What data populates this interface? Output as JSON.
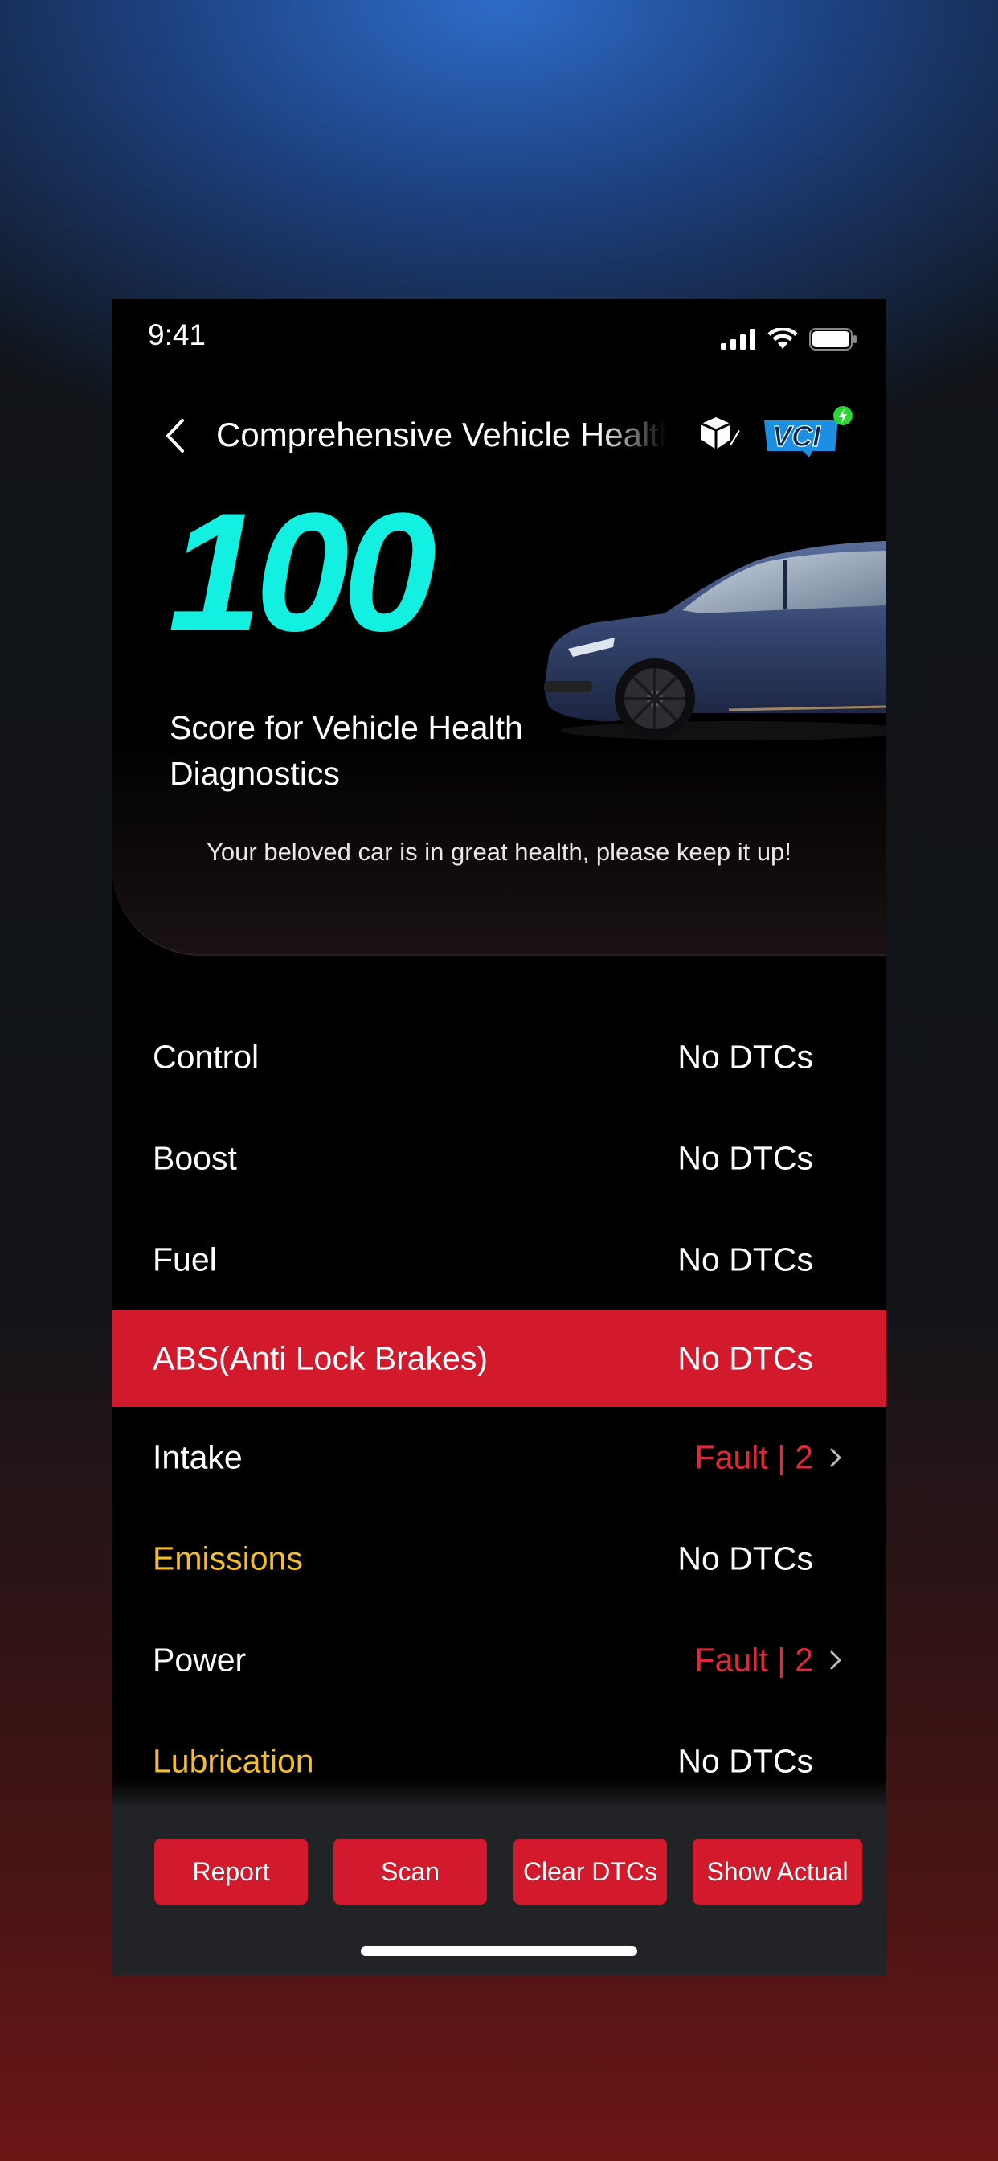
{
  "status_bar": {
    "time": "9:41",
    "icons": [
      "cellular-signal-icon",
      "wifi-icon",
      "battery-icon"
    ]
  },
  "nav": {
    "back_icon": "chevron-left-icon",
    "title": "Comprehensive Vehicle Health Diagnostics",
    "actions": [
      {
        "name": "cube-pencil-icon"
      },
      {
        "name": "vci-connection-icon",
        "label": "VCI",
        "status_color": "#2bd434"
      }
    ]
  },
  "hero": {
    "score": "100",
    "score_label": "Score for Vehicle Health Diagnostics",
    "message": "Your beloved car is in great health, please keep it up!"
  },
  "systems": [
    {
      "name": "Control",
      "status": "No DTCs",
      "fault": false,
      "highlight": false,
      "warning": false
    },
    {
      "name": "Boost",
      "status": "No DTCs",
      "fault": false,
      "highlight": false,
      "warning": false
    },
    {
      "name": "Fuel",
      "status": "No DTCs",
      "fault": false,
      "highlight": false,
      "warning": false
    },
    {
      "name": "ABS(Anti Lock Brakes)",
      "status": "No DTCs",
      "fault": false,
      "highlight": true,
      "warning": false
    },
    {
      "name": "Intake",
      "status": "Fault | 2",
      "fault": true,
      "highlight": false,
      "warning": false
    },
    {
      "name": "Emissions",
      "status": "No DTCs",
      "fault": false,
      "highlight": false,
      "warning": true
    },
    {
      "name": "Power",
      "status": "Fault | 2",
      "fault": true,
      "highlight": false,
      "warning": false
    },
    {
      "name": "Lubrication",
      "status": "No DTCs",
      "fault": false,
      "highlight": false,
      "warning": true
    }
  ],
  "actions": {
    "report": "Report",
    "scan": "Scan",
    "clear_dtcs": "Clear DTCs",
    "show_actual": "Show Actual"
  },
  "colors": {
    "accent_red": "#d21a2c",
    "score_cyan": "#13f0e2",
    "warning_yellow": "#f4bd2b",
    "fault_red": "#e0283a"
  }
}
